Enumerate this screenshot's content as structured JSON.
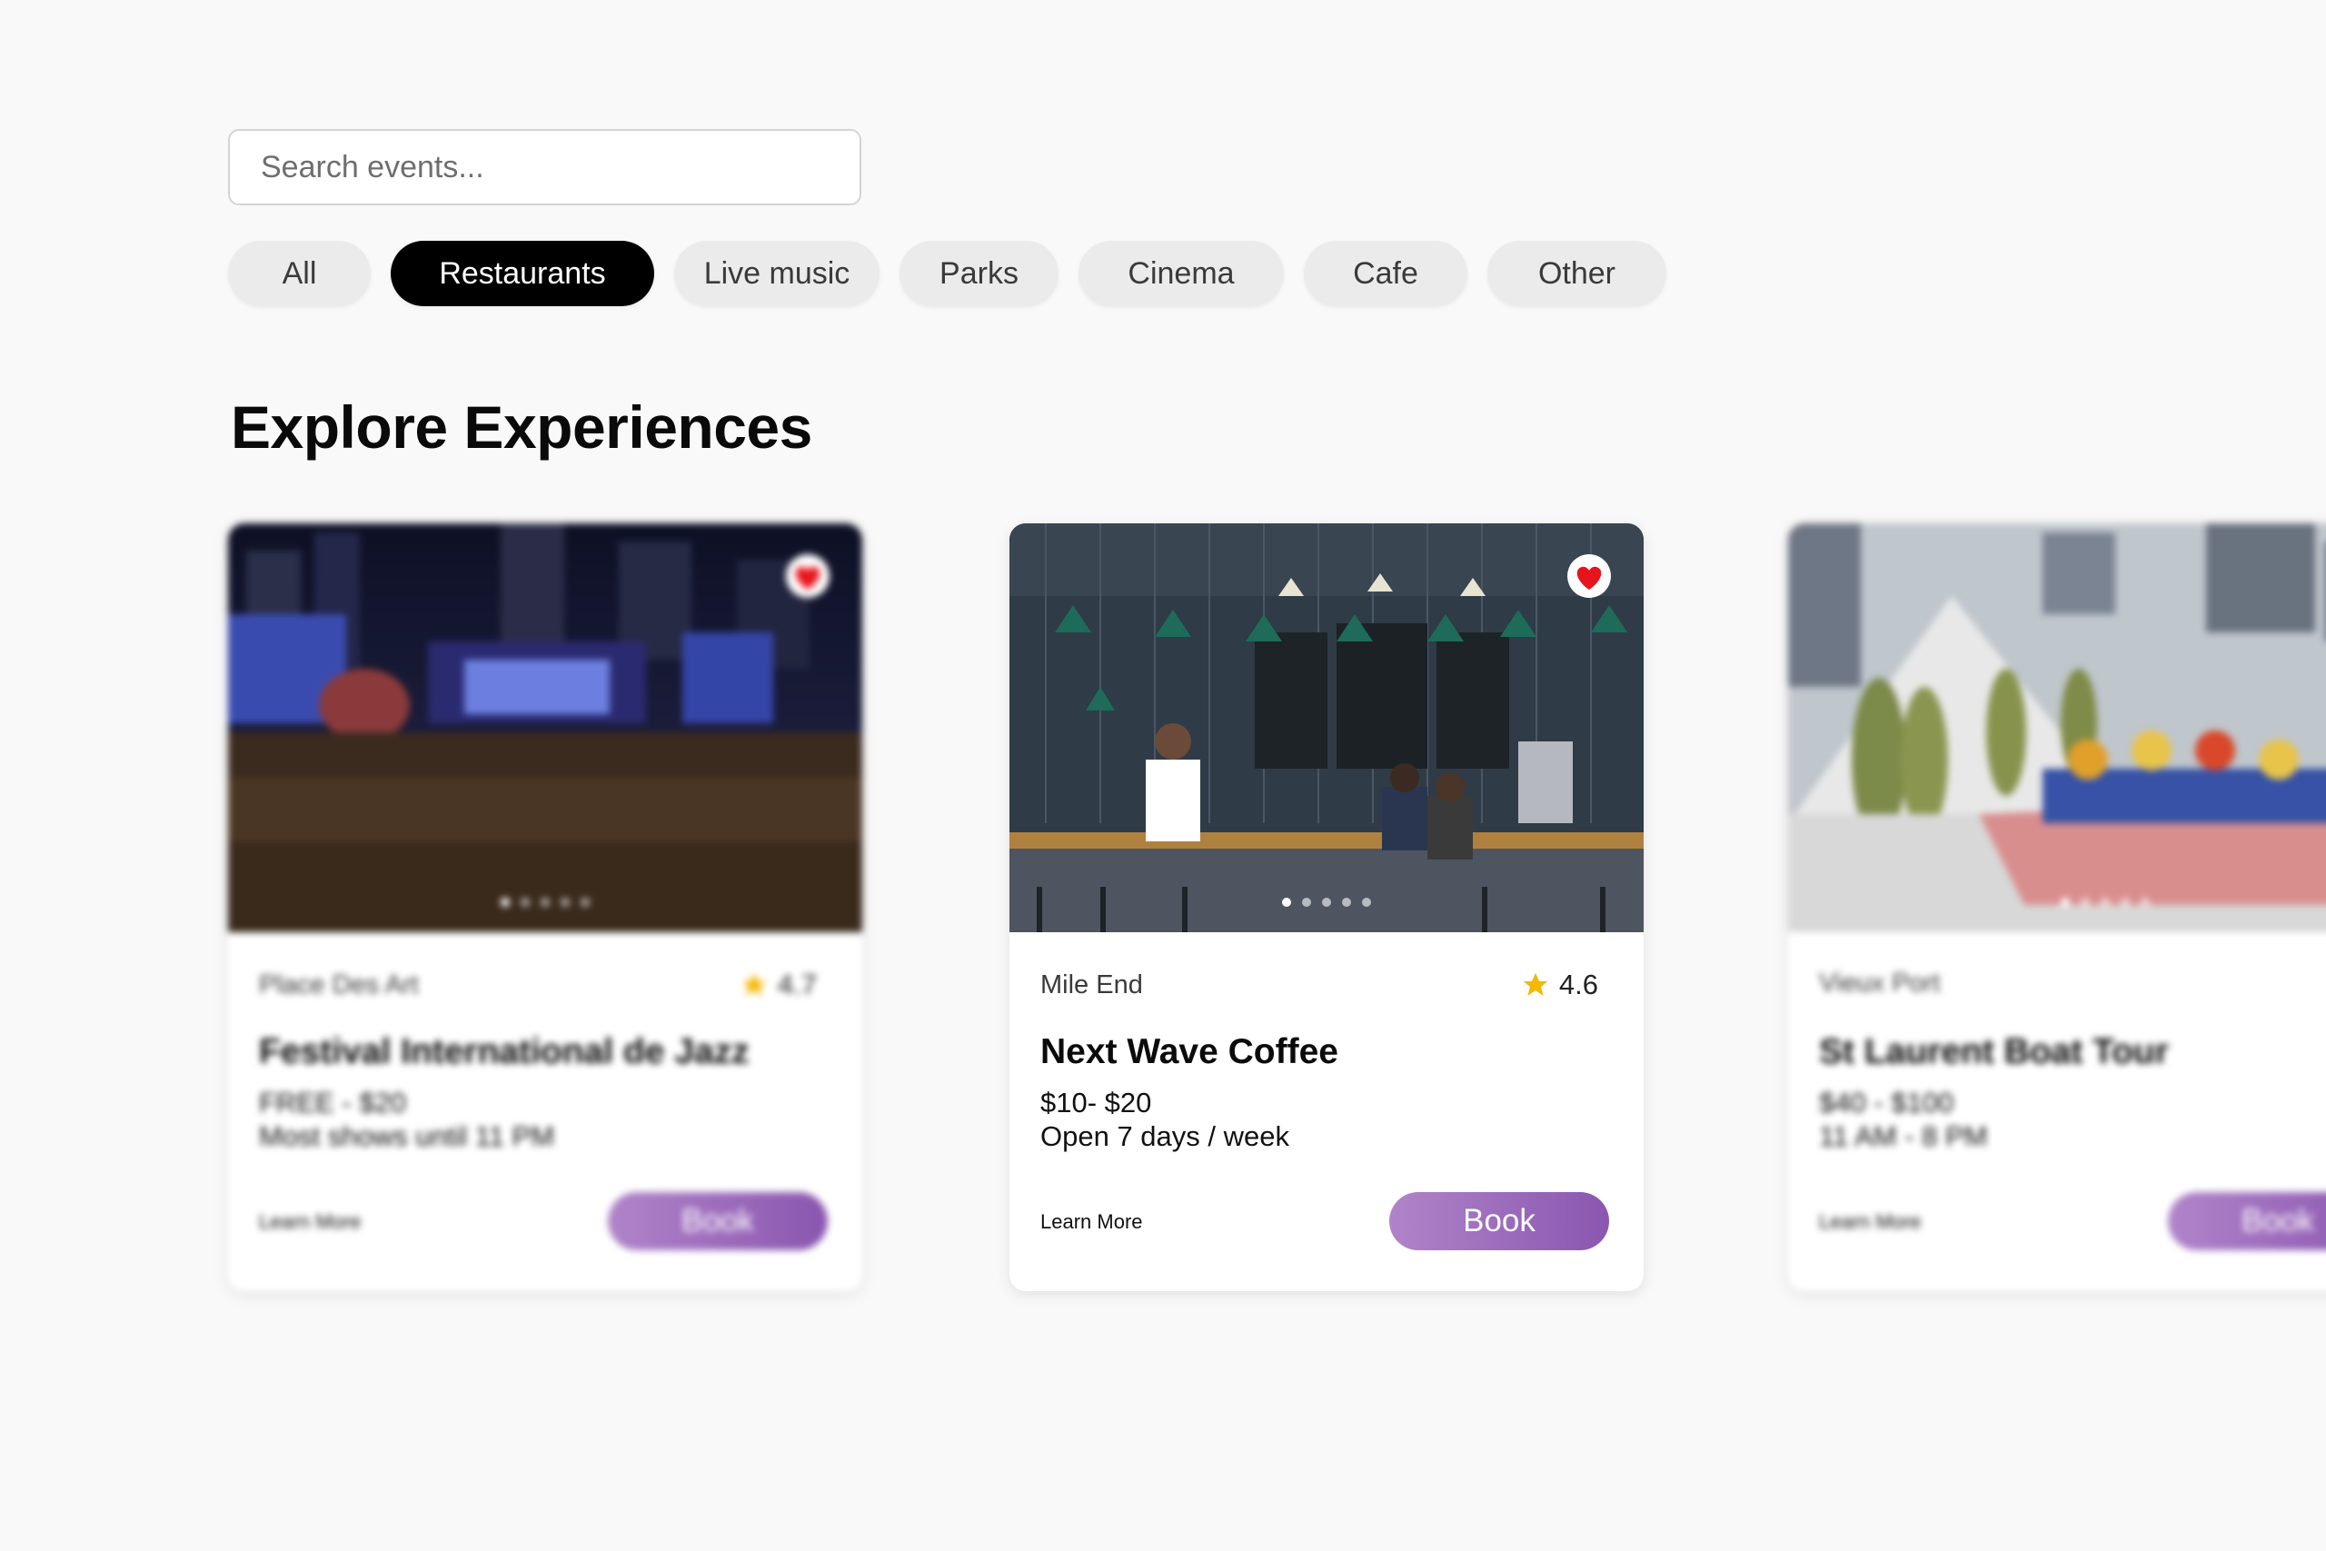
{
  "search": {
    "placeholder": "Search events..."
  },
  "filters": [
    {
      "label": "All",
      "selected": false
    },
    {
      "label": "Restaurants",
      "selected": true
    },
    {
      "label": "Live music",
      "selected": false
    },
    {
      "label": "Parks",
      "selected": false
    },
    {
      "label": "Cinema",
      "selected": false
    },
    {
      "label": "Cafe",
      "selected": false
    },
    {
      "label": "Other",
      "selected": false
    }
  ],
  "section": {
    "title": "Explore Experiences"
  },
  "cards": [
    {
      "location": "Place Des Art",
      "rating": "4.7",
      "title": "Festival International de Jazz",
      "price": "FREE - $20",
      "hours": "Most shows until 11 PM",
      "learn_more": "Learn More",
      "book": "Book",
      "favorited": true,
      "icon": "heart-icon",
      "focused": false
    },
    {
      "location": "Mile End",
      "rating": "4.6",
      "title": "Next Wave Coffee",
      "price": "$10- $20",
      "hours": "Open 7 days / week",
      "learn_more": "Learn More",
      "book": "Book",
      "favorited": true,
      "icon": "heart-icon",
      "focused": true
    },
    {
      "location": "Vieux Port",
      "rating": "",
      "title": "St Laurent Boat Tour",
      "price": "$40 - $100",
      "hours": "11 AM - 8 PM",
      "learn_more": "Learn More",
      "book": "Book",
      "favorited": false,
      "icon": "heart-icon",
      "focused": false
    }
  ],
  "colors": {
    "background": "#f9f9f9",
    "chip_active_bg": "#000000",
    "chip_bg": "#ebebeb",
    "heart": "#e8141c",
    "star": "#f5b800",
    "book_gradient_start": "#b084c9",
    "book_gradient_end": "#8a56b0"
  }
}
